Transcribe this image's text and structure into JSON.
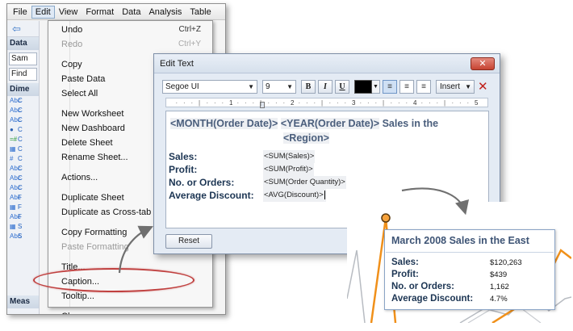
{
  "menubar": {
    "items": [
      "File",
      "Edit",
      "View",
      "Format",
      "Data",
      "Analysis",
      "Table"
    ]
  },
  "sidebar": {
    "data_header": "Data",
    "data_source": "Sam",
    "find_box": "Find",
    "dimensions_header": "Dime",
    "measures_header": "Meas",
    "rows": [
      {
        "icon": "Abc",
        "label": "C"
      },
      {
        "icon": "Abc",
        "label": "C"
      },
      {
        "icon": "Abc",
        "label": "C"
      },
      {
        "icon": "●",
        "label": "C"
      },
      {
        "icon": "=#",
        "label": "C"
      },
      {
        "icon": "▦",
        "label": "C"
      },
      {
        "icon": "#",
        "label": "C"
      },
      {
        "icon": "Abc",
        "label": "C"
      },
      {
        "icon": "Abc",
        "label": "C"
      },
      {
        "icon": "Abc",
        "label": "C"
      },
      {
        "icon": "Abc",
        "label": "F"
      },
      {
        "icon": "▦",
        "label": "F"
      },
      {
        "icon": "Abc",
        "label": "F"
      },
      {
        "icon": "▦",
        "label": "S"
      },
      {
        "icon": "Abc",
        "label": "S"
      }
    ]
  },
  "edit_menu": {
    "items": [
      {
        "label": "Undo",
        "shortcut": "Ctrl+Z",
        "disabled": false
      },
      {
        "label": "Redo",
        "shortcut": "Ctrl+Y",
        "disabled": true
      },
      {
        "sep": true
      },
      {
        "label": "Copy",
        "shortcut": "",
        "disabled": false
      },
      {
        "label": "Paste Data",
        "shortcut": "",
        "disabled": false
      },
      {
        "label": "Select All",
        "shortcut": "",
        "disabled": false
      },
      {
        "sep": true
      },
      {
        "label": "New Worksheet",
        "shortcut": "",
        "disabled": false
      },
      {
        "label": "New Dashboard",
        "shortcut": "",
        "disabled": false
      },
      {
        "label": "Delete Sheet",
        "shortcut": "",
        "disabled": false
      },
      {
        "label": "Rename Sheet...",
        "shortcut": "",
        "disabled": false
      },
      {
        "sep": true
      },
      {
        "label": "Actions...",
        "shortcut": "",
        "disabled": false
      },
      {
        "sep": true
      },
      {
        "label": "Duplicate Sheet",
        "shortcut": "",
        "disabled": false
      },
      {
        "label": "Duplicate as Cross-tab",
        "shortcut": "",
        "disabled": false
      },
      {
        "sep": true
      },
      {
        "label": "Copy Formatting",
        "shortcut": "",
        "disabled": false
      },
      {
        "label": "Paste Formatting",
        "shortcut": "",
        "disabled": true
      },
      {
        "sep": true
      },
      {
        "label": "Title...",
        "shortcut": "",
        "disabled": false
      },
      {
        "label": "Caption...",
        "shortcut": "",
        "disabled": false
      },
      {
        "label": "Tooltip...",
        "shortcut": "",
        "disabled": false
      },
      {
        "sep": true
      },
      {
        "label": "Clear",
        "shortcut": "",
        "disabled": false,
        "submenu": true
      }
    ]
  },
  "dialog": {
    "title": "Edit Text",
    "close_label": "✕",
    "font_family": "Segoe UI",
    "font_size": "9",
    "bold_label": "B",
    "italic_label": "I",
    "underline_label": "U",
    "text_color": "#000000",
    "insert_label": "Insert",
    "ruler_ticks": [
      "1",
      "2",
      "3",
      "4",
      "5"
    ],
    "title_line1_parts": [
      "<MONTH(Order Date)>",
      "<YEAR(Order Date)>",
      "Sales in the"
    ],
    "title_line2": "<Region>",
    "fields": [
      {
        "label": "Sales:",
        "value": "<SUM(Sales)>"
      },
      {
        "label": "Profit:",
        "value": "<SUM(Profit)>"
      },
      {
        "label": "No. or Orders:",
        "value": "<SUM(Order Quantity)>"
      },
      {
        "label": "Average Discount:",
        "value": "<AVG(Discount)>"
      }
    ],
    "reset_label": "Reset"
  },
  "tooltip_preview": {
    "title": "March 2008 Sales in the East",
    "rows": [
      {
        "label": "Sales:",
        "value": "$120,263"
      },
      {
        "label": "Profit:",
        "value": "$439"
      },
      {
        "label": "No. or Orders:",
        "value": "1,162"
      },
      {
        "label": "Average Discount:",
        "value": "4.7%"
      }
    ]
  },
  "colors": {
    "accent_blue": "#4a5e7c",
    "highlight_red": "#c0403f",
    "chart_orange": "#f0901a",
    "chart_gray": "#b8bcc2"
  }
}
